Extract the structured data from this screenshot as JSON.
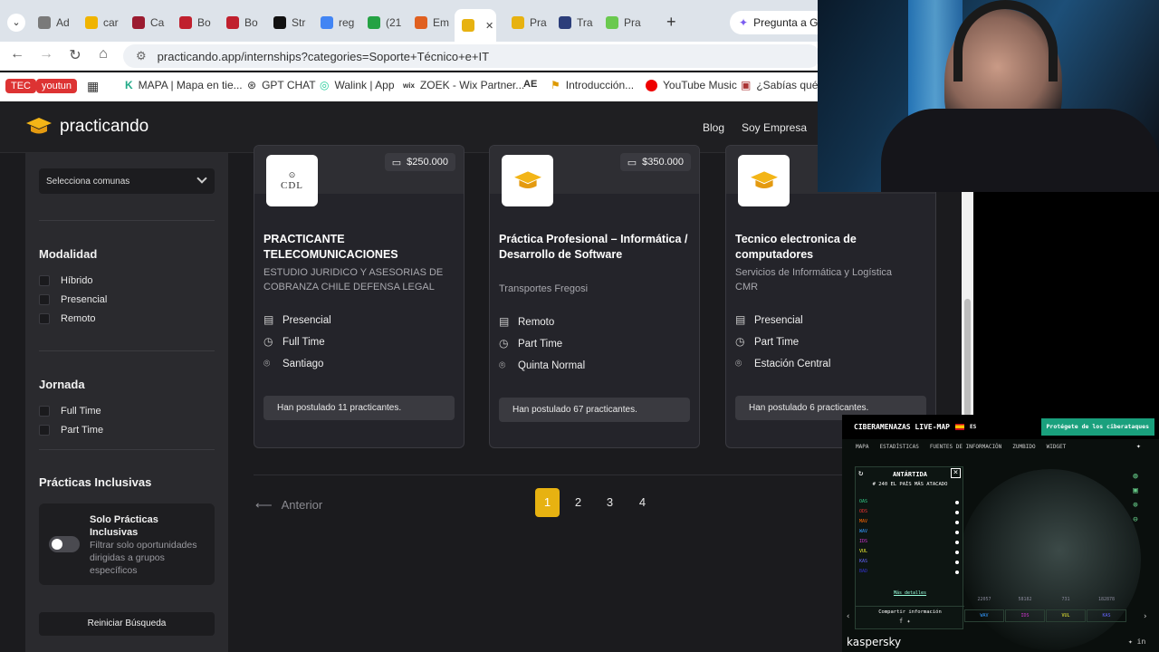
{
  "browser": {
    "tabs": [
      {
        "label": "Ad",
        "color": "#7a7a7a"
      },
      {
        "label": "car",
        "color": "#f0b400"
      },
      {
        "label": "Ca",
        "color": "#9b1b30"
      },
      {
        "label": "Bo",
        "color": "#c0202e"
      },
      {
        "label": "Bo",
        "color": "#c0202e"
      },
      {
        "label": "Str",
        "color": "#111"
      },
      {
        "label": "reg",
        "color": "#4285f4"
      },
      {
        "label": "(21",
        "color": "#25a244"
      },
      {
        "label": "Em",
        "color": "#e06020"
      },
      {
        "label": "",
        "color": "#e7b211",
        "active": true,
        "close": "✕"
      },
      {
        "label": "Pra",
        "color": "#e7b211"
      },
      {
        "label": "Tra",
        "color": "#2c3e7a"
      },
      {
        "label": "Pra",
        "color": "#6ac94f"
      }
    ],
    "new_tab": "+",
    "gemini": "Pregunta a Ge",
    "url": "practicando.app/internships?categories=Soporte+Técnico+e+IT",
    "bookmarks": [
      "TEC",
      "youtun",
      "MAPA | Mapa en tie...",
      "GPT CHAT",
      "Walink | App",
      "ZOEK - Wix Partner...",
      "AE",
      "Introducción...",
      "YouTube Music",
      "¿Sabías qué Le"
    ]
  },
  "site": {
    "brand": "practicando",
    "nav": [
      "Blog",
      "Soy Empresa"
    ]
  },
  "sidebar": {
    "comunas_placeholder": "Selecciona comunas",
    "modalidad": {
      "title": "Modalidad",
      "options": [
        "Híbrido",
        "Presencial",
        "Remoto"
      ]
    },
    "jornada": {
      "title": "Jornada",
      "options": [
        "Full Time",
        "Part Time"
      ]
    },
    "inclusivas": {
      "title": "Prácticas Inclusivas",
      "toggle_title": "Solo Prácticas Inclusivas",
      "toggle_desc": "Filtrar solo oportunidades dirigidas a grupos específicos"
    },
    "reset": "Reiniciar Búsqueda"
  },
  "cards": [
    {
      "price": "$250.000",
      "logo": "CDL",
      "title": "PRACTICANTE TELECOMUNICACIONES",
      "company": "ESTUDIO JURIDICO Y ASESORIAS DE COBRANZA CHILE DEFENSA LEGAL",
      "modality": "Presencial",
      "schedule": "Full Time",
      "location": "Santiago",
      "applied": "Han postulado 11 practicantes."
    },
    {
      "price": "$350.000",
      "logo": "",
      "title": "Práctica Profesional – Informática / Desarrollo de Software",
      "company": "Transportes Fregosi",
      "modality": "Remoto",
      "schedule": "Part Time",
      "location": "Quinta Normal",
      "applied": "Han postulado 67 practicantes."
    },
    {
      "price": "",
      "logo": "",
      "title": "Tecnico electronica de computadores",
      "company": "Servicios de Informática y Logística CMR",
      "modality": "Presencial",
      "schedule": "Part Time",
      "location": "Estación Central",
      "applied": "Han postulado 6 practicantes."
    }
  ],
  "pagination": {
    "prev": "Anterior",
    "pages": [
      "1",
      "2",
      "3",
      "4"
    ],
    "current": "1"
  },
  "kaspersky": {
    "title": "CIBERAMENAZAS LIVE-MAP",
    "lang": "ES",
    "protect": "Protégete de los ciberataques",
    "menu": [
      "MAPA",
      "ESTADÍSTICAS",
      "FUENTES DE INFORMACIÓN",
      "ZUMBIDO",
      "WIDGET"
    ],
    "country": "ANTÁRTIDA",
    "rank": "# 240 EL PAÍS MÁS ATACADO",
    "legend": [
      "OAS",
      "ODS",
      "MAV",
      "WAV",
      "IDS",
      "VUL",
      "KAS",
      "BAD"
    ],
    "more": "Más detalles",
    "share": "Compartir información",
    "stats": [
      "WAV",
      "IDS",
      "VUL",
      "KAS"
    ],
    "nums": [
      "22057",
      "58182",
      "731",
      "182878"
    ],
    "brand": "kaspersky"
  }
}
